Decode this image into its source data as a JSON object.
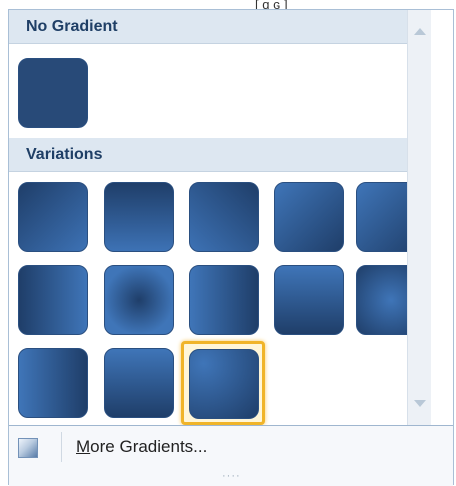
{
  "sections": {
    "no_gradient": {
      "title": "No Gradient"
    },
    "variations": {
      "title": "Variations"
    }
  },
  "swatches": {
    "no_gradient": {
      "label": "No Gradient",
      "base_color": "#2a4f80"
    },
    "variations_selected_index": 12,
    "variation_count": 13
  },
  "footer": {
    "more_prefix": "M",
    "more_label_rest": "ore Gradients...",
    "resize_grip": "····"
  },
  "top_artifact": "[ ɑ ɢ ]",
  "colors": {
    "header_bg": "#dde7f1",
    "header_text": "#1f3f66",
    "swatch_dark": "#1e3b66",
    "swatch_mid": "#3f73b7",
    "selected_border": "#f0b429"
  }
}
